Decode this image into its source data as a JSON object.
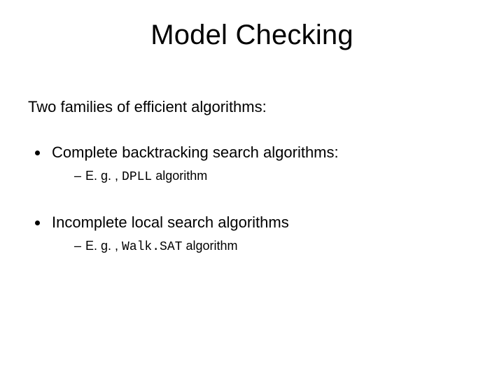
{
  "title": "Model Checking",
  "intro": "Two families of efficient algorithms:",
  "bullets": [
    {
      "text": "Complete backtracking search algorithms:",
      "sub": {
        "prefix": "E. g. , ",
        "mono": "DPLL",
        "suffix": " algorithm"
      }
    },
    {
      "text": "Incomplete local search algorithms",
      "sub": {
        "prefix": "E. g. , ",
        "mono": "Walk.SAT",
        "suffix": " algorithm"
      }
    }
  ]
}
